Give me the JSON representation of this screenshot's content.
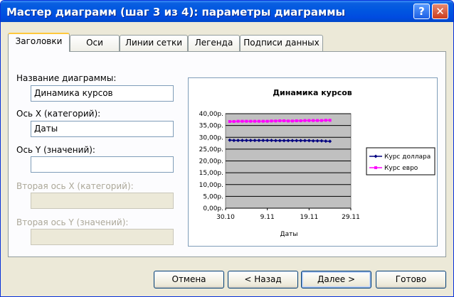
{
  "window": {
    "title": "Мастер диаграмм (шаг 3 из 4): параметры диаграммы",
    "help_glyph": "?",
    "close_glyph": "✕"
  },
  "tabs": [
    {
      "label": "Заголовки",
      "active": true
    },
    {
      "label": "Оси",
      "active": false
    },
    {
      "label": "Линии сетки",
      "active": false
    },
    {
      "label": "Легенда",
      "active": false
    },
    {
      "label": "Подписи данных",
      "active": false
    }
  ],
  "form": {
    "chart_title_label": "Название диаграммы:",
    "chart_title_value": "Динамика курсов",
    "x_axis_label": "Ось X (категорий):",
    "x_axis_value": "Даты",
    "y_axis_label": "Ось Y (значений):",
    "y_axis_value": "",
    "x2_axis_label": "Вторая ось X (категорий):",
    "x2_axis_value": "",
    "y2_axis_label": "Вторая ось Y (значений):",
    "y2_axis_value": ""
  },
  "buttons": {
    "cancel": "Отмена",
    "back": "< Назад",
    "next": "Далее >",
    "finish": "Готово"
  },
  "colors": {
    "plot_area": "#c0c0c0",
    "series_dollar": "#000080",
    "series_euro": "#ff00ff"
  },
  "chart_data": {
    "type": "line",
    "title": "Динамика курсов",
    "xlabel": "Даты",
    "ylabel": "",
    "ylim": [
      0,
      40
    ],
    "yticks": [
      "0,00р.",
      "5,00р.",
      "10,00р.",
      "15,00р.",
      "20,00р.",
      "25,00р.",
      "30,00р.",
      "35,00р.",
      "40,00р."
    ],
    "xticks": [
      "30.10",
      "9.11",
      "19.11",
      "29.11"
    ],
    "x": [
      "31.10",
      "1.11",
      "2.11",
      "3.11",
      "4.11",
      "5.11",
      "6.11",
      "7.11",
      "8.11",
      "9.11",
      "10.11",
      "11.11",
      "12.11",
      "13.11",
      "14.11",
      "15.11",
      "16.11",
      "17.11",
      "18.11",
      "19.11",
      "20.11",
      "21.11",
      "22.11",
      "23.11",
      "24.11"
    ],
    "series": [
      {
        "name": "Курс доллара",
        "marker": "diamond",
        "values": [
          28.8,
          28.7,
          28.7,
          28.7,
          28.7,
          28.7,
          28.7,
          28.7,
          28.7,
          28.7,
          28.7,
          28.6,
          28.6,
          28.6,
          28.6,
          28.6,
          28.6,
          28.6,
          28.6,
          28.6,
          28.5,
          28.5,
          28.5,
          28.4,
          28.3
        ]
      },
      {
        "name": "Курс евро",
        "marker": "square",
        "values": [
          36.7,
          36.7,
          36.8,
          36.8,
          36.8,
          36.8,
          36.8,
          36.8,
          36.8,
          36.8,
          36.9,
          36.9,
          37.0,
          37.0,
          36.9,
          36.9,
          37.0,
          37.0,
          37.1,
          37.1,
          37.1,
          37.1,
          37.1,
          37.2,
          37.2
        ]
      }
    ],
    "grid": true,
    "legend": "right"
  }
}
